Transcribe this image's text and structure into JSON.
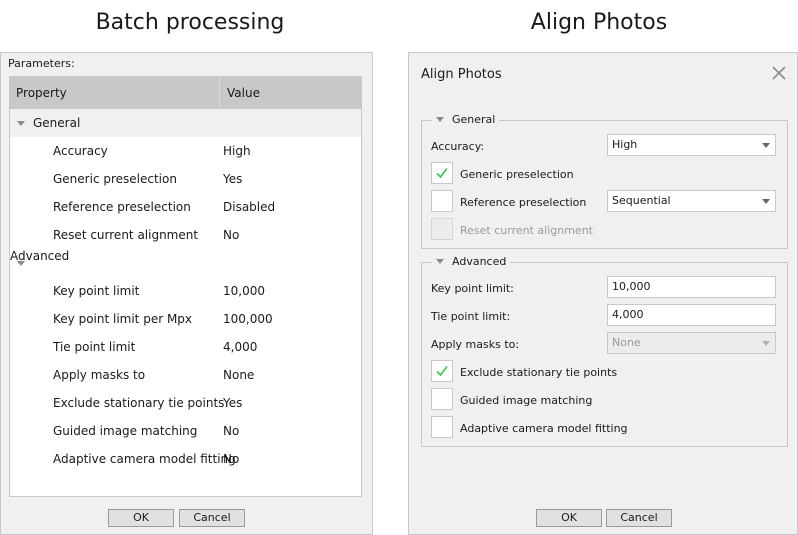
{
  "captions": {
    "left": "Batch processing",
    "right": "Align Photos"
  },
  "batch": {
    "params_label": "Parameters:",
    "columns": {
      "property": "Property",
      "value": "Value"
    },
    "groups": {
      "general": {
        "label": "General",
        "rows": [
          {
            "name": "Accuracy",
            "value": "High"
          },
          {
            "name": "Generic preselection",
            "value": "Yes"
          },
          {
            "name": "Reference preselection",
            "value": "Disabled"
          },
          {
            "name": "Reset current alignment",
            "value": "No"
          }
        ]
      },
      "advanced": {
        "label": "Advanced",
        "rows": [
          {
            "name": "Key point limit",
            "value": "10,000"
          },
          {
            "name": "Key point limit per Mpx",
            "value": "100,000"
          },
          {
            "name": "Tie point limit",
            "value": "4,000"
          },
          {
            "name": "Apply masks to",
            "value": "None"
          },
          {
            "name": "Exclude stationary tie points",
            "value": "Yes"
          },
          {
            "name": "Guided image matching",
            "value": "No"
          },
          {
            "name": "Adaptive camera model fitting",
            "value": "No"
          }
        ]
      }
    },
    "ok_label": "OK",
    "cancel_label": "Cancel"
  },
  "dialog": {
    "title": "Align Photos",
    "close_icon": "close-icon",
    "general": {
      "legend": "General",
      "accuracy_label": "Accuracy:",
      "accuracy_value": "High",
      "generic_preselection_label": "Generic preselection",
      "generic_preselection_checked": true,
      "reference_preselection_label": "Reference preselection",
      "reference_preselection_checked": false,
      "reference_preselection_value": "Sequential",
      "reset_alignment_label": "Reset current alignment",
      "reset_alignment_enabled": false
    },
    "advanced": {
      "legend": "Advanced",
      "key_point_label": "Key point limit:",
      "key_point_value": "10,000",
      "tie_point_label": "Tie point limit:",
      "tie_point_value": "4,000",
      "masks_label": "Apply masks to:",
      "masks_value": "None",
      "exclude_stationary_label": "Exclude stationary tie points",
      "exclude_stationary_checked": true,
      "guided_matching_label": "Guided image matching",
      "guided_matching_checked": false,
      "adaptive_fitting_label": "Adaptive camera model fitting",
      "adaptive_fitting_checked": false
    },
    "ok_label": "OK",
    "cancel_label": "Cancel"
  },
  "colors": {
    "check": "#3cc24a",
    "header_bg": "#c8c8c8",
    "panel_bg": "#f0f0f0"
  }
}
